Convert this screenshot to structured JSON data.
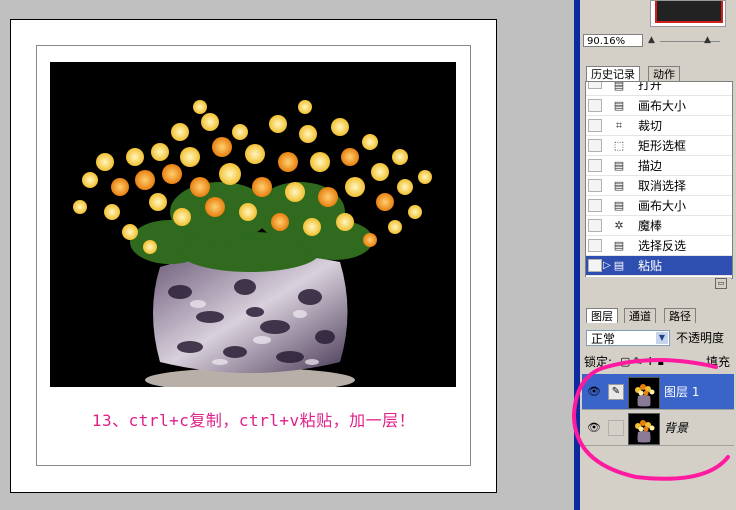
{
  "document": {
    "caption": "13、ctrl+c复制，ctrl+v粘贴，加一层！"
  },
  "navigator": {
    "zoom": "90.16%"
  },
  "history_panel": {
    "tabs": [
      {
        "label": "历史记录",
        "active": true
      },
      {
        "label": "动作",
        "active": false
      }
    ],
    "items": [
      {
        "label": "打开",
        "icon": "document-icon",
        "selected": false
      },
      {
        "label": "画布大小",
        "icon": "document-icon",
        "selected": false
      },
      {
        "label": "裁切",
        "icon": "crop-icon",
        "selected": false
      },
      {
        "label": "矩形选框",
        "icon": "marquee-icon",
        "selected": false
      },
      {
        "label": "描边",
        "icon": "document-icon",
        "selected": false
      },
      {
        "label": "取消选择",
        "icon": "document-icon",
        "selected": false
      },
      {
        "label": "画布大小",
        "icon": "document-icon",
        "selected": false
      },
      {
        "label": "魔棒",
        "icon": "magic-wand-icon",
        "selected": false
      },
      {
        "label": "选择反选",
        "icon": "document-icon",
        "selected": false
      },
      {
        "label": "粘贴",
        "icon": "document-icon",
        "selected": true
      }
    ]
  },
  "layers_panel": {
    "tabs": [
      {
        "label": "图层",
        "active": true
      },
      {
        "label": "通道",
        "active": false
      },
      {
        "label": "路径",
        "active": false
      }
    ],
    "blend_mode": "正常",
    "opacity_label": "不透明度",
    "lock_label": "锁定:",
    "fill_label": "填充",
    "layers": [
      {
        "name": "图层 1",
        "selected": true
      },
      {
        "name": "背景",
        "selected": false
      }
    ]
  },
  "colors": {
    "caption": "#e0208a",
    "selection": "#3a64c8",
    "annotation_circle": "#ff1aa0"
  }
}
